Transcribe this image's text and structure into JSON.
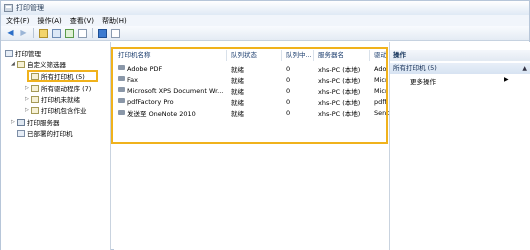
{
  "window": {
    "title": "打印管理"
  },
  "menu": [
    "文件(F)",
    "操作(A)",
    "查看(V)",
    "帮助(H)"
  ],
  "toolbar": {
    "buttons": [
      "back-icon",
      "forward-icon",
      "folder-icon",
      "view-icon",
      "refresh-icon",
      "export-icon",
      "help-icon",
      "page-icon"
    ]
  },
  "tree": {
    "root": "打印管理",
    "custom_filters": "自定义筛选器",
    "all_printers": "所有打印机 (5)",
    "all_drivers": "所有驱动程序 (7)",
    "printers_not_ready": "打印机未就绪",
    "printers_with_jobs": "打印机包含作业",
    "print_servers": "打印服务器",
    "deployed_printers": "已部署的打印机"
  },
  "list": {
    "columns": [
      "打印机名称",
      "队列状态",
      "队列中...",
      "服务器名",
      "驱动"
    ],
    "rows": [
      {
        "name": "Adobe PDF",
        "status": "就绪",
        "jobs": "0",
        "server": "xhs-PC (本地)",
        "driver": "Ado"
      },
      {
        "name": "Fax",
        "status": "就绪",
        "jobs": "0",
        "server": "xhs-PC (本地)",
        "driver": "Micr"
      },
      {
        "name": "Microsoft XPS Document Wr...",
        "status": "就绪",
        "jobs": "0",
        "server": "xhs-PC (本地)",
        "driver": "Micr"
      },
      {
        "name": "pdfFactory Pro",
        "status": "就绪",
        "jobs": "0",
        "server": "xhs-PC (本地)",
        "driver": "pdff"
      },
      {
        "name": "发送至 OneNote 2010",
        "status": "就绪",
        "jobs": "0",
        "server": "xhs-PC (本地)",
        "driver": "Senc"
      }
    ]
  },
  "actions": {
    "header": "操作",
    "group": "所有打印机 (5)",
    "more": "更多操作"
  },
  "colors": {
    "highlight": "#f0b21c",
    "accent": "#2b6ec7"
  }
}
